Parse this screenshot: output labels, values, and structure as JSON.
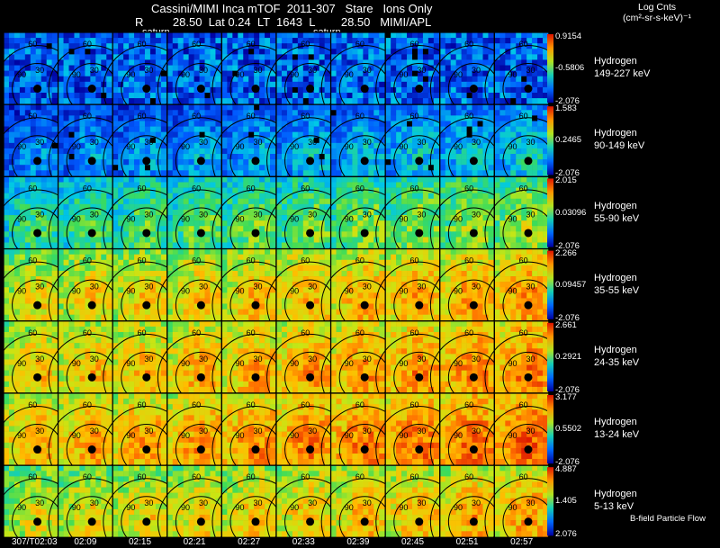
{
  "header": {
    "line1": "Cassini/MIMI Inca mTOF  2011-307   Stare   Ions Only",
    "line2": "R         28.50  Lat 0.24  LT  1643  L        28.50   MIMI/APL",
    "saturn_labels": [
      "saturn",
      "saturn"
    ],
    "units_title": "Log Cnts",
    "units": "(cm²-sr-s-keV)⁻¹"
  },
  "rows": [
    {
      "species": "Hydrogen",
      "energy": "149-227 keV",
      "cbar_max": "0.9154",
      "cbar_mid": "-0.5806",
      "cbar_min": "-2.076",
      "level": 0.18
    },
    {
      "species": "Hydrogen",
      "energy": "90-149 keV",
      "cbar_max": "1.583",
      "cbar_mid": "0.2465",
      "cbar_min": "-2.076",
      "level": 0.3
    },
    {
      "species": "Hydrogen",
      "energy": "55-90 keV",
      "cbar_max": "2.015",
      "cbar_mid": "0.03096",
      "cbar_min": "-2.076",
      "level": 0.52
    },
    {
      "species": "Hydrogen",
      "energy": "35-55 keV",
      "cbar_max": "2.266",
      "cbar_mid": "0.09457",
      "cbar_min": "-2.076",
      "level": 0.72
    },
    {
      "species": "Hydrogen",
      "energy": "24-35 keV",
      "cbar_max": "2.661",
      "cbar_mid": "0.2921",
      "cbar_min": "-2.076",
      "level": 0.76
    },
    {
      "species": "Hydrogen",
      "energy": "13-24 keV",
      "cbar_max": "3.177",
      "cbar_mid": "0.5502",
      "cbar_min": "-2.076",
      "level": 0.8
    },
    {
      "species": "Hydrogen",
      "energy": "5-13 keV",
      "cbar_max": "4.887",
      "cbar_mid": "1.405",
      "cbar_min": "2.076",
      "level": 0.7
    }
  ],
  "times": [
    "307/T02:03",
    "02:09",
    "02:15",
    "02:21",
    "02:27",
    "02:33",
    "02:39",
    "02:45",
    "02:51",
    "02:57"
  ],
  "contour_labels": [
    "60",
    "30",
    "90"
  ],
  "footer_note": "B-field Particle Flow"
}
